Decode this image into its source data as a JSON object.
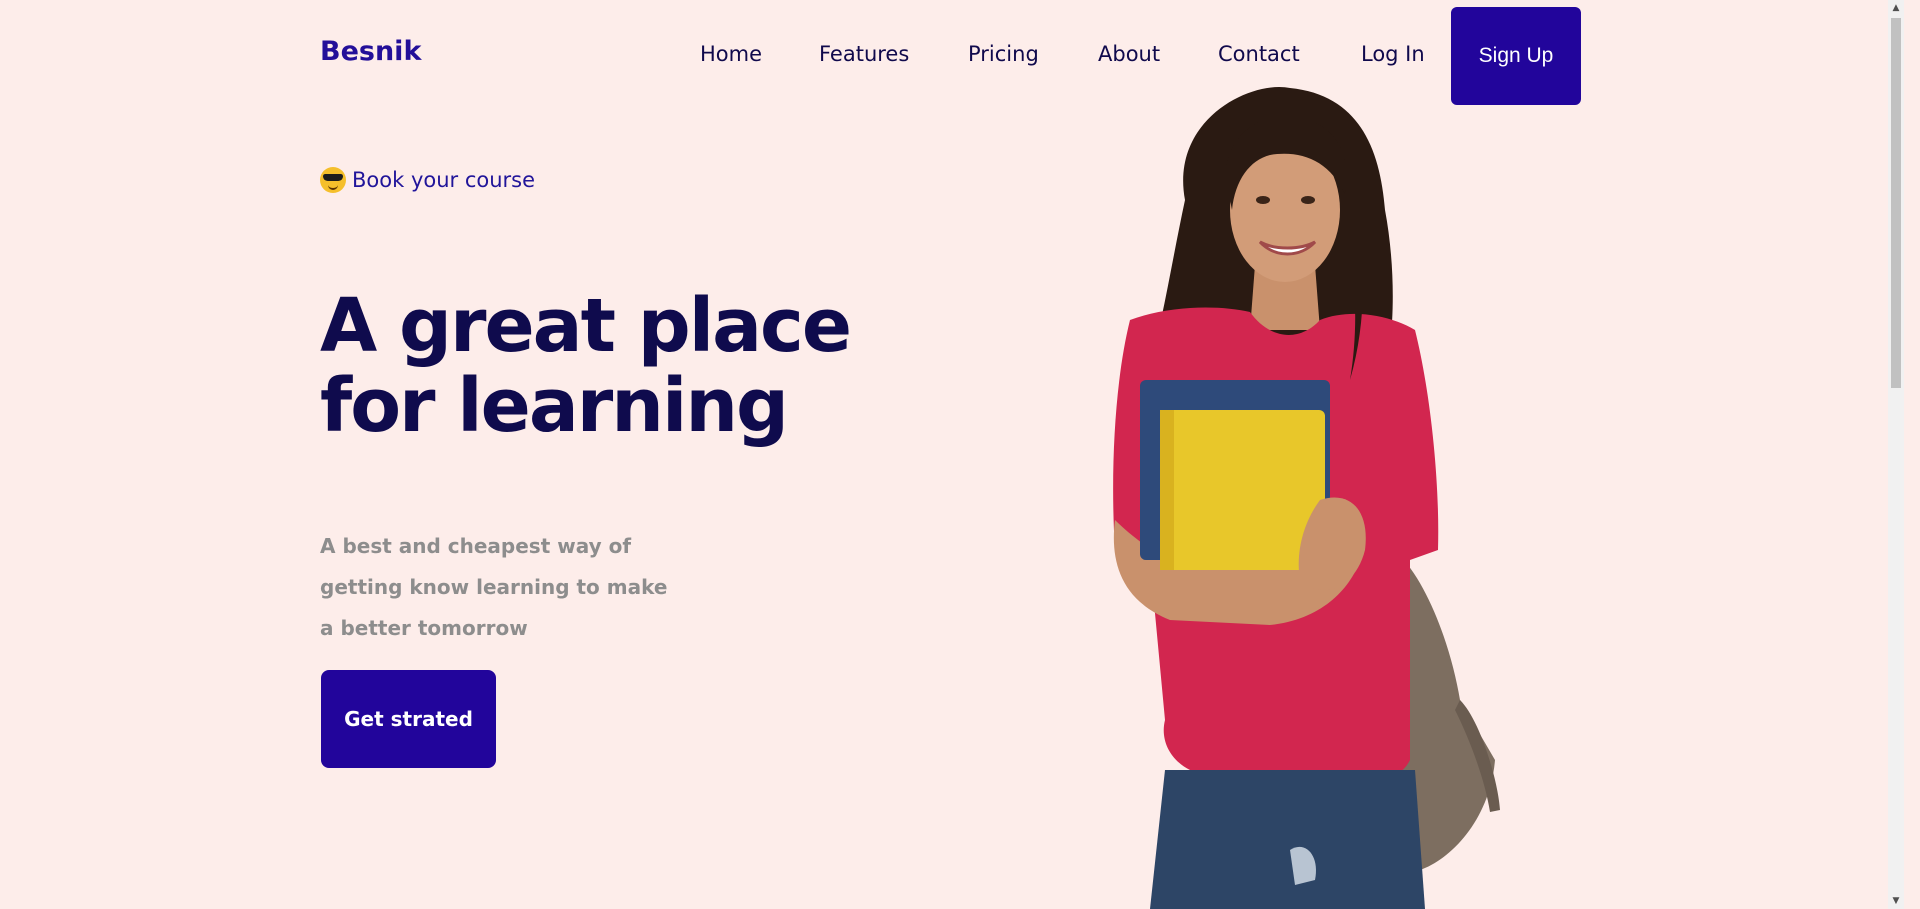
{
  "brand": {
    "name": "Besnik"
  },
  "nav": {
    "items": [
      {
        "label": "Home"
      },
      {
        "label": "Features"
      },
      {
        "label": "Pricing"
      },
      {
        "label": "About"
      },
      {
        "label": "Contact"
      },
      {
        "label": "Log In"
      }
    ],
    "signup_label": "Sign Up"
  },
  "hero": {
    "eyebrow": "Book your course",
    "eyebrow_icon": "sunglasses-emoji-icon",
    "title_line1": "A great place",
    "title_line2": "for learning",
    "description_line1": "A best and cheapest way of",
    "description_line2": "getting know learning to make",
    "description_line3": "a better tomorrow",
    "cta_label": "Get strated",
    "image": "student-with-books-image"
  },
  "colors": {
    "background": "#fdedea",
    "accent": "#22059b",
    "heading": "#0f0b4d",
    "muted": "#8d8d8d"
  }
}
